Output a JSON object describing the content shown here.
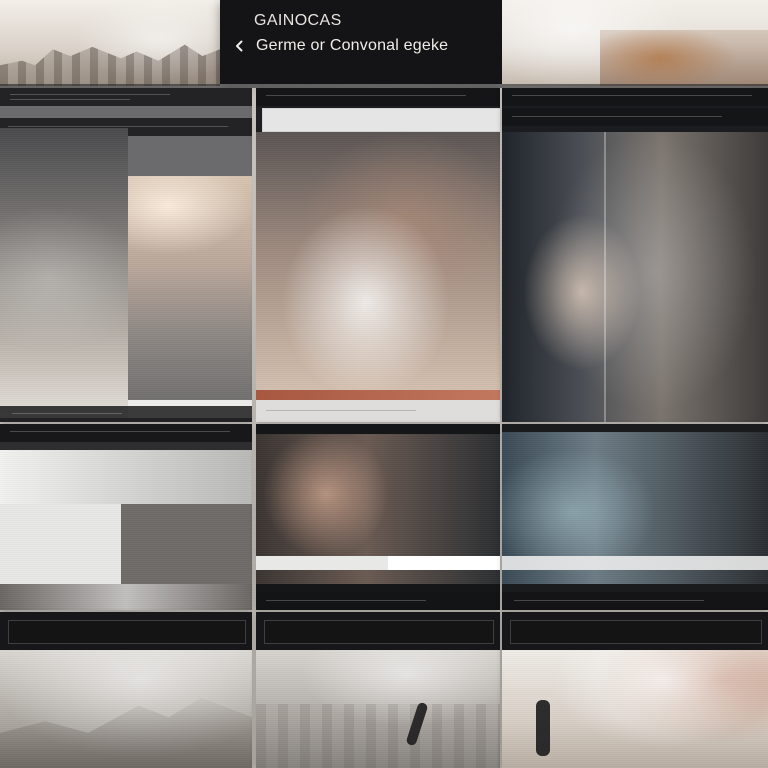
{
  "header": {
    "title_top": "GAINOCAS",
    "title_main": "Germe or Convonal egeke"
  }
}
